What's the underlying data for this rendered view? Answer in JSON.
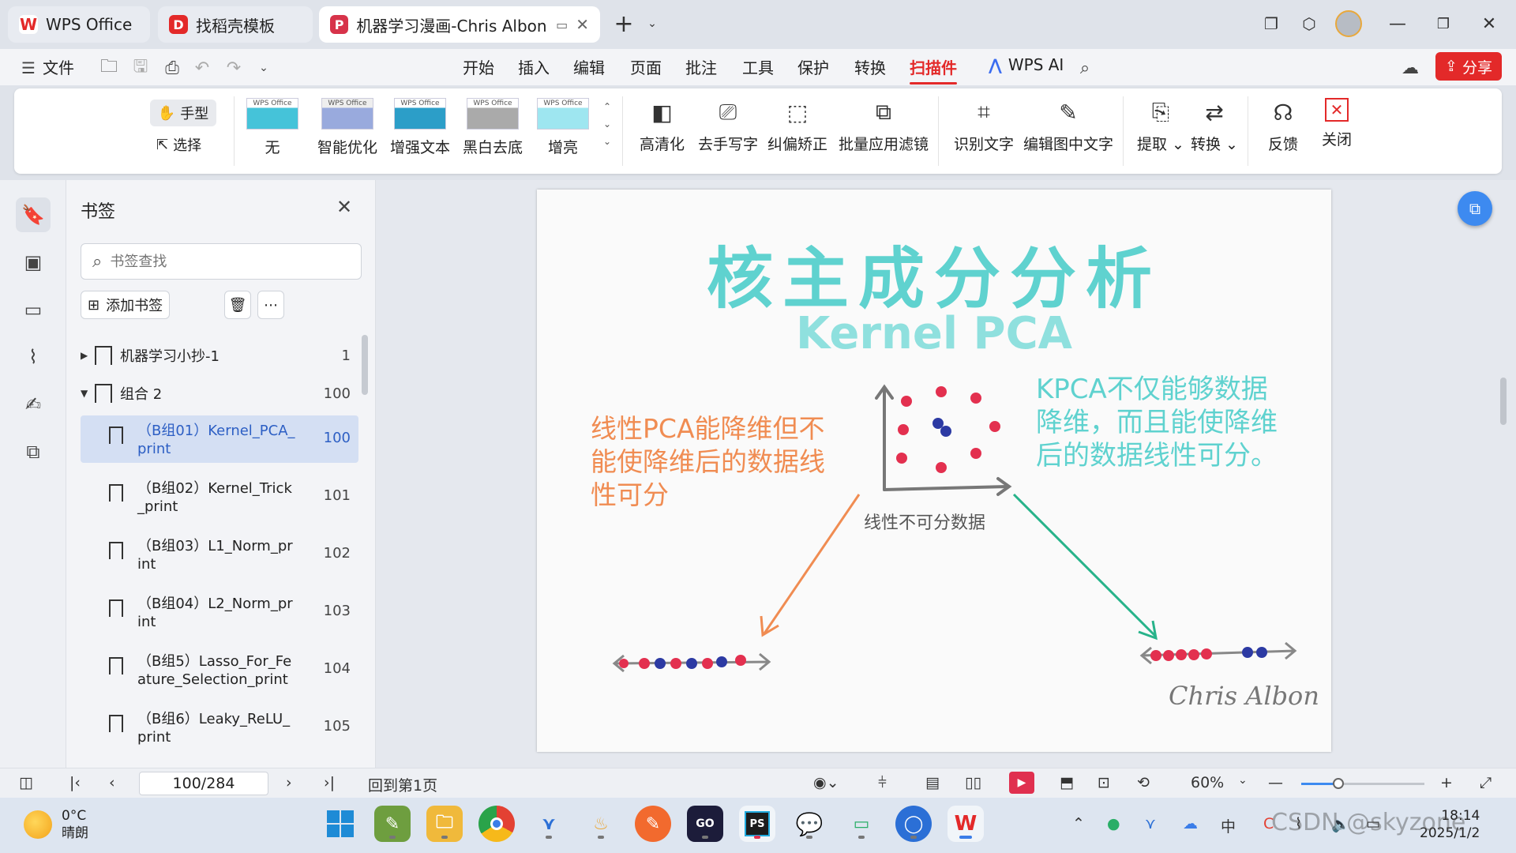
{
  "tabs": [
    {
      "label": "WPS Office",
      "logo": "W",
      "color": "#e32929"
    },
    {
      "label": "找稻壳模板",
      "logo": "D",
      "color": "#e32929"
    },
    {
      "label": "机器学习漫画-Chris Albon.pd",
      "logo": "P",
      "color": "#d7334a"
    }
  ],
  "menu": {
    "file_label": "文件",
    "items": [
      "开始",
      "插入",
      "编辑",
      "页面",
      "批注",
      "工具",
      "保护",
      "转换",
      "扫描件"
    ],
    "active": "扫描件",
    "ai_label": "WPS AI",
    "share_label": "分享"
  },
  "ribbon": {
    "hand_label": "手型",
    "select_label": "选择",
    "filters": [
      "无",
      "智能优化",
      "增强文本",
      "黑白去底",
      "增亮"
    ],
    "filter_thumb_text": "WPS Office",
    "tools": [
      "高清化",
      "去手写字",
      "纠偏矫正",
      "批量应用滤镜",
      "识别文字",
      "编辑图中文字",
      "提取",
      "转换",
      "反馈",
      "关闭"
    ]
  },
  "bookmark_panel": {
    "title": "书签",
    "search_placeholder": "书签查找",
    "add_label": "添加书签",
    "top_items": [
      {
        "label": "机器学习小抄-1",
        "page": "1",
        "expanded": false
      },
      {
        "label": "组合 2",
        "page": "100",
        "expanded": true
      }
    ],
    "children": [
      {
        "label": "（B组01）Kernel_PCA_print",
        "page": "100",
        "selected": true
      },
      {
        "label": "（B组02）Kernel_Trick_print",
        "page": "101",
        "selected": false
      },
      {
        "label": "（B组03）L1_Norm_print",
        "page": "102",
        "selected": false
      },
      {
        "label": "（B组04）L2_Norm_print",
        "page": "103",
        "selected": false
      },
      {
        "label": "（B组5）Lasso_For_Feature_Selection_print",
        "page": "104",
        "selected": false
      },
      {
        "label": "（B组6）Leaky_ReLU_print",
        "page": "105",
        "selected": false
      }
    ]
  },
  "document": {
    "title": "核主成分分析",
    "subtitle": "Kernel PCA",
    "left_text": "线性PCA能降维但不能使降维后的数据线性可分",
    "right_text": "KPCA不仅能够数据降维，而且能使降维后的数据线性可分。",
    "middle_text": "线性不可分数据",
    "signature": "Chris Albon",
    "colors": {
      "teal": "#5fd2cf",
      "orange": "#f08c52",
      "red": "#e3304f",
      "blue": "#2c3aa3",
      "green": "#27b38a"
    }
  },
  "status": {
    "page_value": "100/284",
    "back_label": "回到第1页",
    "zoom_label": "60%",
    "zoom_level": 0.3
  },
  "taskbar": {
    "temp": "0°C",
    "weather": "晴朗",
    "time": "18:14",
    "date": "2025/1/2",
    "ime": "中",
    "watermark": "CSDN @skyzone"
  }
}
